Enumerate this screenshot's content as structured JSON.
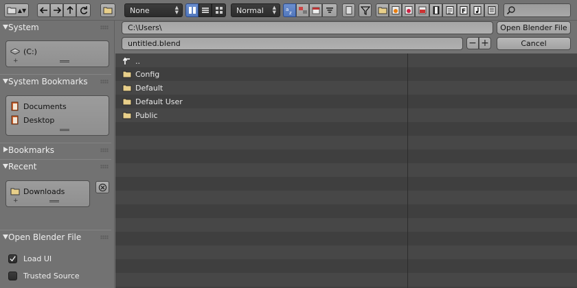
{
  "toolbar": {
    "display_mode": "None",
    "thumbnail_size": "Normal",
    "search": {
      "value": "",
      "placeholder": ""
    }
  },
  "sidebar": {
    "system": {
      "title": "System",
      "items": [
        {
          "label": "(C:)"
        }
      ]
    },
    "system_bookmarks": {
      "title": "System Bookmarks",
      "items": [
        {
          "label": "Documents"
        },
        {
          "label": "Desktop"
        }
      ]
    },
    "bookmarks": {
      "title": "Bookmarks"
    },
    "recent": {
      "title": "Recent",
      "items": [
        {
          "label": "Downloads"
        }
      ]
    },
    "operator": {
      "title": "Open Blender File",
      "options": [
        {
          "label": "Load UI",
          "checked": true
        },
        {
          "label": "Trusted Source",
          "checked": false
        }
      ]
    }
  },
  "path": {
    "directory": "C:\\Users\\",
    "filename": "untitled.blend",
    "open_label": "Open Blender File",
    "cancel_label": "Cancel"
  },
  "files": [
    {
      "name": "..",
      "type": "parent"
    },
    {
      "name": "Config",
      "type": "folder"
    },
    {
      "name": "Default",
      "type": "folder"
    },
    {
      "name": "Default User",
      "type": "folder"
    },
    {
      "name": "Public",
      "type": "folder"
    }
  ],
  "colors": {
    "accent": "#5177bd",
    "folder": "#e8cf8a",
    "bookmark_icon": "#d4622c"
  }
}
